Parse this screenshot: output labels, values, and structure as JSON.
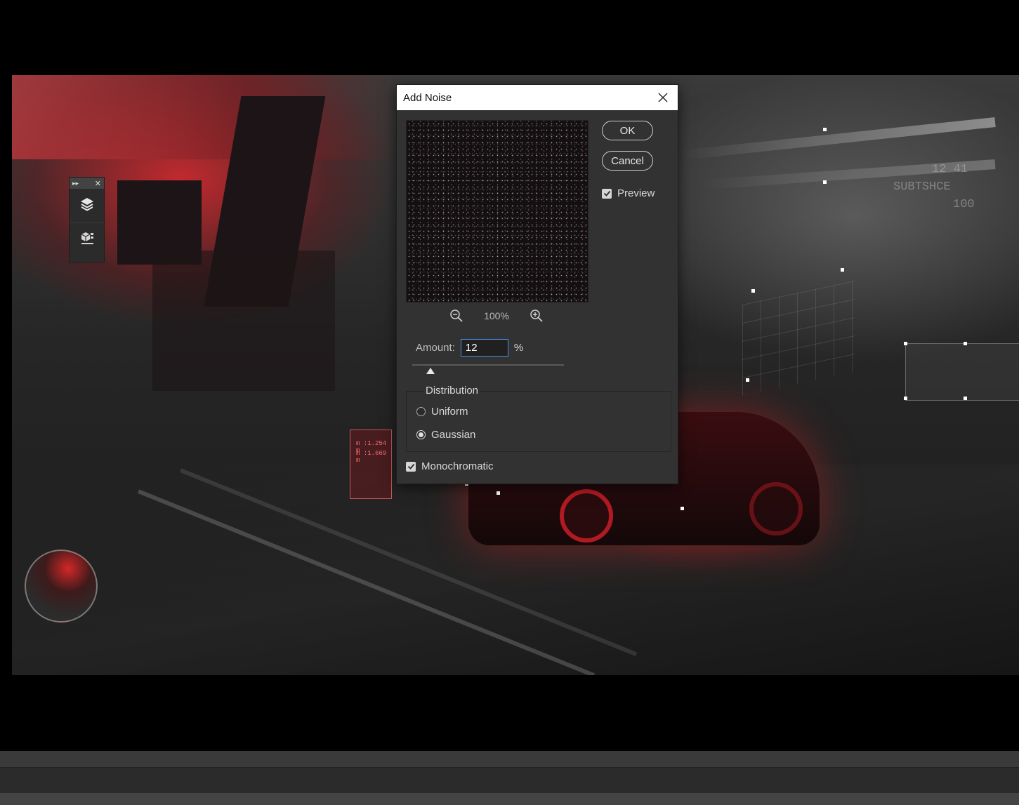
{
  "dialog": {
    "title": "Add Noise",
    "ok_label": "OK",
    "cancel_label": "Cancel",
    "preview_label": "Preview",
    "preview_checked": true,
    "zoom_level": "100%",
    "amount_label": "Amount:",
    "amount_value": "12",
    "amount_unit": "%",
    "amount_slider_fraction": 0.12,
    "distribution": {
      "legend": "Distribution",
      "options": [
        {
          "label": "Uniform",
          "selected": false
        },
        {
          "label": "Gaussian",
          "selected": true
        }
      ]
    },
    "monochromatic_label": "Monochromatic",
    "monochromatic_checked": true
  },
  "tool_panel": {
    "buttons": [
      {
        "icon": "layers-icon"
      },
      {
        "icon": "3d-object-icon"
      }
    ]
  },
  "canvas": {
    "hud_lines": [
      "m :1.254 m",
      "m :1.669 m"
    ],
    "hud_right_lines": [
      "12 41",
      "SUBTSHCE",
      "100"
    ]
  },
  "colors": {
    "accent_red": "#d9262d",
    "dialog_bg": "#323232",
    "input_focus": "#4b8ee6"
  }
}
